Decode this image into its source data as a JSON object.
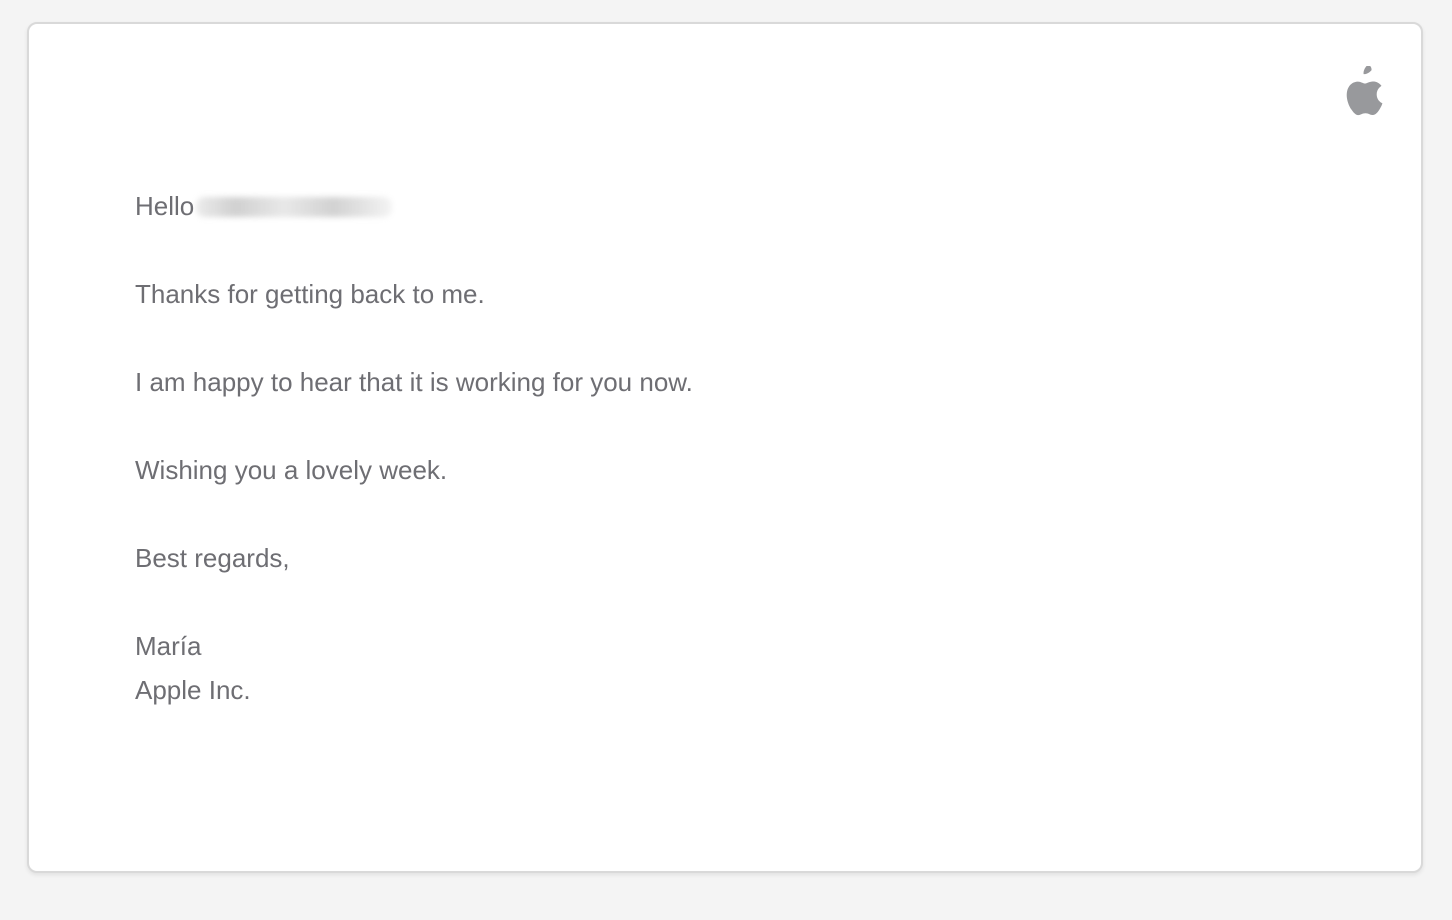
{
  "email": {
    "brand_logo": "apple-logo-icon",
    "greeting": "Hello",
    "recipient_name_redacted": true,
    "paragraphs": [
      "Thanks for getting back to me.",
      "I am happy to hear that it is working for you now.",
      "Wishing you a lovely week.",
      "Best regards,"
    ],
    "signature": {
      "name": "María",
      "company": "Apple Inc."
    }
  },
  "colors": {
    "page_background": "#f4f4f4",
    "card_background": "#ffffff",
    "text": "#6e6e73",
    "logo": "#98999c",
    "border": "#d9d9d9"
  }
}
